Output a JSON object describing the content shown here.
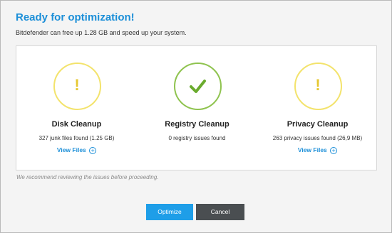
{
  "header": {
    "title": "Ready for optimization!",
    "subtitle": "Bitdefender can free up 1.28 GB and speed up your system."
  },
  "items": [
    {
      "status": "warning",
      "icon": "exclamation-icon",
      "icon_glyph": "!",
      "title": "Disk Cleanup",
      "description": "327 junk files found (1.25 GB)",
      "link": "View Files"
    },
    {
      "status": "ok",
      "icon": "checkmark-icon",
      "title": "Registry Cleanup",
      "description": "0 registry issues found"
    },
    {
      "status": "warning",
      "icon": "exclamation-icon",
      "icon_glyph": "!",
      "title": "Privacy Cleanup",
      "description": "263 privacy issues found (26,9 MB)",
      "link": "View Files"
    }
  ],
  "note": "We recommend reviewing the issues before proceeding.",
  "buttons": {
    "primary": "Optimize",
    "secondary": "Cancel"
  },
  "colors": {
    "accent": "#1c8fd8",
    "warning": "#f3e36c",
    "ok": "#8fc34f",
    "primary_button": "#1e9ee8",
    "secondary_button": "#4a4e51"
  }
}
